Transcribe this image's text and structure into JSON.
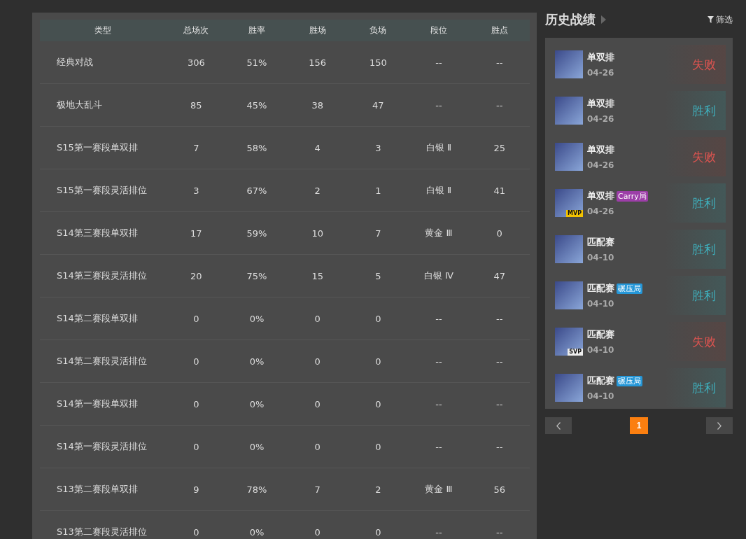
{
  "stats_table": {
    "columns": [
      "类型",
      "总场次",
      "胜率",
      "胜场",
      "负场",
      "段位",
      "胜点"
    ],
    "rows": [
      [
        "经典对战",
        "306",
        "51%",
        "156",
        "150",
        "--",
        "--"
      ],
      [
        "极地大乱斗",
        "85",
        "45%",
        "38",
        "47",
        "--",
        "--"
      ],
      [
        "S15第一赛段单双排",
        "7",
        "58%",
        "4",
        "3",
        "白银 Ⅱ",
        "25"
      ],
      [
        "S15第一赛段灵活排位",
        "3",
        "67%",
        "2",
        "1",
        "白银 Ⅱ",
        "41"
      ],
      [
        "S14第三赛段单双排",
        "17",
        "59%",
        "10",
        "7",
        "黄金 Ⅲ",
        "0"
      ],
      [
        "S14第三赛段灵活排位",
        "20",
        "75%",
        "15",
        "5",
        "白银 Ⅳ",
        "47"
      ],
      [
        "S14第二赛段单双排",
        "0",
        "0%",
        "0",
        "0",
        "--",
        "--"
      ],
      [
        "S14第二赛段灵活排位",
        "0",
        "0%",
        "0",
        "0",
        "--",
        "--"
      ],
      [
        "S14第一赛段单双排",
        "0",
        "0%",
        "0",
        "0",
        "--",
        "--"
      ],
      [
        "S14第一赛段灵活排位",
        "0",
        "0%",
        "0",
        "0",
        "--",
        "--"
      ],
      [
        "S13第二赛段单双排",
        "9",
        "78%",
        "7",
        "2",
        "黄金 Ⅲ",
        "56"
      ],
      [
        "S13第二赛段灵活排位",
        "0",
        "0%",
        "0",
        "0",
        "--",
        "--"
      ]
    ]
  },
  "history": {
    "title": "历史战绩",
    "filter_label": "筛选",
    "matches": [
      {
        "mode": "单双排",
        "date": "04-26",
        "kind": "loss",
        "result": "失败"
      },
      {
        "mode": "单双排",
        "date": "04-26",
        "kind": "win",
        "result": "胜利"
      },
      {
        "mode": "单双排",
        "date": "04-26",
        "kind": "loss",
        "result": "失败"
      },
      {
        "mode": "单双排",
        "date": "04-26",
        "kind": "win",
        "result": "胜利",
        "badge": "MVP",
        "tag": {
          "text": "Carry局",
          "color": "#9c3ea8"
        }
      },
      {
        "mode": "匹配赛",
        "date": "04-10",
        "kind": "win",
        "result": "胜利"
      },
      {
        "mode": "匹配赛",
        "date": "04-10",
        "kind": "win",
        "result": "胜利",
        "tag": {
          "text": "碾压局",
          "color": "#2597d8"
        }
      },
      {
        "mode": "匹配赛",
        "date": "04-10",
        "kind": "loss",
        "result": "失败",
        "badge": "SVP"
      },
      {
        "mode": "匹配赛",
        "date": "04-10",
        "kind": "win",
        "result": "胜利",
        "tag": {
          "text": "碾压局",
          "color": "#2597d8"
        }
      }
    ],
    "pages": [
      {
        "label": "1",
        "selected": true
      }
    ]
  }
}
